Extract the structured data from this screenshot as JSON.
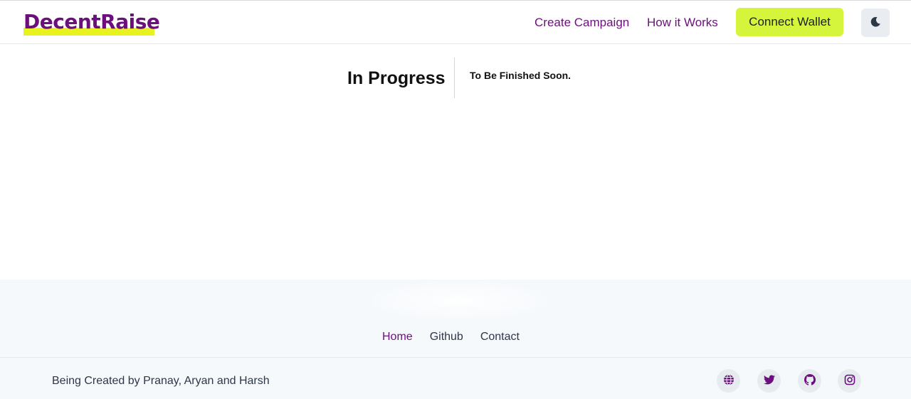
{
  "header": {
    "brand": "DecentRaise",
    "nav": [
      "Create Campaign",
      "How it Works"
    ],
    "connect_label": "Connect Wallet",
    "theme_icon": "moon-icon"
  },
  "hero": {
    "title": "In Progress",
    "subtitle": "To Be Finished Soon."
  },
  "footer": {
    "links": [
      "Home",
      "Github",
      "Contact"
    ],
    "active_link": "Home",
    "credit": "Being Created by Pranay, Aryan and Harsh",
    "social_icons": [
      "globe-icon",
      "twitter-icon",
      "github-icon",
      "instagram-icon"
    ]
  },
  "colors": {
    "brand": "#6b0f7c",
    "accent": "#d4f53b",
    "footer_bg": "#f6f9fc"
  }
}
